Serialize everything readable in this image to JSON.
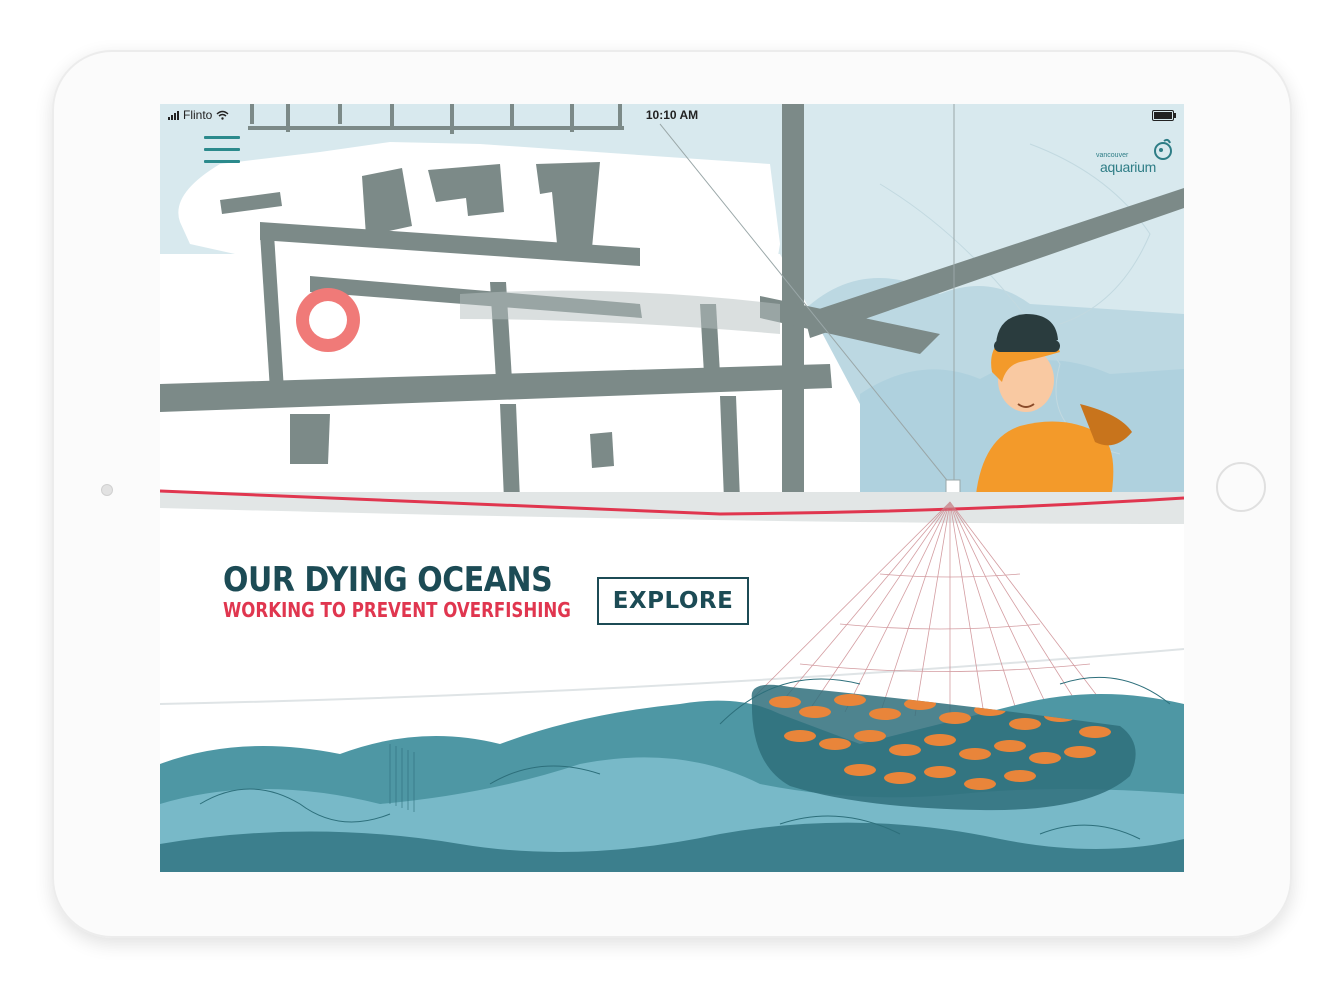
{
  "device": {
    "type": "tablet"
  },
  "status_bar": {
    "carrier": "Flinto",
    "time": "10:10 AM"
  },
  "header": {
    "menu_icon": "hamburger-menu-icon",
    "logo": {
      "small_text": "vancouver",
      "main_text": "aquarium",
      "icon": "aquarium-logo-icon"
    }
  },
  "hero": {
    "title": "OUR DYING OCEANS",
    "subtitle": "WORKING TO PREVENT OVERFISHING",
    "cta_label": "EXPLORE"
  },
  "colors": {
    "title": "#1c4b55",
    "subtitle": "#e0364f",
    "accent_line": "#e0364f",
    "menu": "#2b8a8c",
    "sky": "#d7e8ec",
    "boat_gray": "#7c8a88",
    "sea": "#4e97a4",
    "fish": "#e9853a",
    "jacket": "#f39a2a"
  }
}
